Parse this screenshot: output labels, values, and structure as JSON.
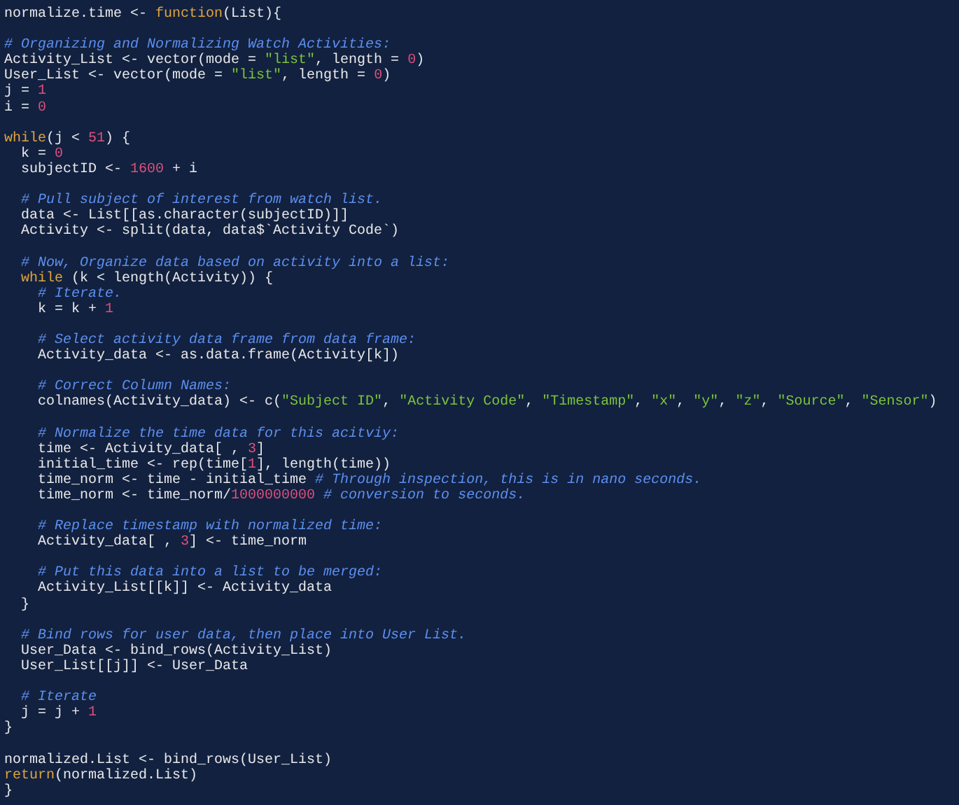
{
  "editor": {
    "lines": [
      {
        "kind": "code",
        "tokens": [
          {
            "kind": "plain",
            "text": "normalize.time <- "
          },
          {
            "kind": "keyword",
            "text": "function"
          },
          {
            "kind": "plain",
            "text": "(List){"
          }
        ]
      },
      {
        "kind": "blank"
      },
      {
        "kind": "code",
        "tokens": [
          {
            "kind": "comment",
            "text": "# Organizing and Normalizing Watch Activities:"
          }
        ]
      },
      {
        "kind": "code",
        "tokens": [
          {
            "kind": "plain",
            "text": "Activity_List <- vector(mode = "
          },
          {
            "kind": "string",
            "text": "\"list\""
          },
          {
            "kind": "plain",
            "text": ", length = "
          },
          {
            "kind": "number",
            "text": "0"
          },
          {
            "kind": "plain",
            "text": ")"
          }
        ]
      },
      {
        "kind": "code",
        "tokens": [
          {
            "kind": "plain",
            "text": "User_List <- vector(mode = "
          },
          {
            "kind": "string",
            "text": "\"list\""
          },
          {
            "kind": "plain",
            "text": ", length = "
          },
          {
            "kind": "number",
            "text": "0"
          },
          {
            "kind": "plain",
            "text": ")"
          }
        ]
      },
      {
        "kind": "code",
        "tokens": [
          {
            "kind": "plain",
            "text": "j = "
          },
          {
            "kind": "number",
            "text": "1"
          }
        ]
      },
      {
        "kind": "code",
        "tokens": [
          {
            "kind": "plain",
            "text": "i = "
          },
          {
            "kind": "number",
            "text": "0"
          }
        ]
      },
      {
        "kind": "blank"
      },
      {
        "kind": "code",
        "tokens": [
          {
            "kind": "keyword",
            "text": "while"
          },
          {
            "kind": "plain",
            "text": "(j < "
          },
          {
            "kind": "number",
            "text": "51"
          },
          {
            "kind": "plain",
            "text": ") {"
          }
        ]
      },
      {
        "kind": "code",
        "tokens": [
          {
            "kind": "plain",
            "text": "  k = "
          },
          {
            "kind": "number",
            "text": "0"
          }
        ]
      },
      {
        "kind": "code",
        "tokens": [
          {
            "kind": "plain",
            "text": "  subjectID <- "
          },
          {
            "kind": "number",
            "text": "1600"
          },
          {
            "kind": "plain",
            "text": " + i"
          }
        ]
      },
      {
        "kind": "blank"
      },
      {
        "kind": "code",
        "tokens": [
          {
            "kind": "comment",
            "text": "  # Pull subject of interest from watch list."
          }
        ]
      },
      {
        "kind": "code",
        "tokens": [
          {
            "kind": "plain",
            "text": "  data <- List[[as.character(subjectID)]]"
          }
        ]
      },
      {
        "kind": "code",
        "tokens": [
          {
            "kind": "plain",
            "text": "  Activity <- split(data, data$`Activity Code`)"
          }
        ]
      },
      {
        "kind": "blank"
      },
      {
        "kind": "code",
        "tokens": [
          {
            "kind": "comment",
            "text": "  # Now, Organize data based on activity into a list:"
          }
        ]
      },
      {
        "kind": "code",
        "tokens": [
          {
            "kind": "keyword",
            "text": "  while"
          },
          {
            "kind": "plain",
            "text": " (k < length(Activity)) {"
          }
        ]
      },
      {
        "kind": "code",
        "tokens": [
          {
            "kind": "comment",
            "text": "    # Iterate."
          }
        ]
      },
      {
        "kind": "code",
        "tokens": [
          {
            "kind": "plain",
            "text": "    k = k + "
          },
          {
            "kind": "number",
            "text": "1"
          }
        ]
      },
      {
        "kind": "blank"
      },
      {
        "kind": "code",
        "tokens": [
          {
            "kind": "comment",
            "text": "    # Select activity data frame from data frame:"
          }
        ]
      },
      {
        "kind": "code",
        "tokens": [
          {
            "kind": "plain",
            "text": "    Activity_data <- as.data.frame(Activity[k])"
          }
        ]
      },
      {
        "kind": "blank"
      },
      {
        "kind": "code",
        "tokens": [
          {
            "kind": "comment",
            "text": "    # Correct Column Names:"
          }
        ]
      },
      {
        "kind": "code",
        "tokens": [
          {
            "kind": "plain",
            "text": "    colnames(Activity_data) <- c("
          },
          {
            "kind": "string",
            "text": "\"Subject ID\""
          },
          {
            "kind": "plain",
            "text": ", "
          },
          {
            "kind": "string",
            "text": "\"Activity Code\""
          },
          {
            "kind": "plain",
            "text": ", "
          },
          {
            "kind": "string",
            "text": "\"Timestamp\""
          },
          {
            "kind": "plain",
            "text": ", "
          },
          {
            "kind": "string",
            "text": "\"x\""
          },
          {
            "kind": "plain",
            "text": ", "
          },
          {
            "kind": "string",
            "text": "\"y\""
          },
          {
            "kind": "plain",
            "text": ", "
          },
          {
            "kind": "string",
            "text": "\"z\""
          },
          {
            "kind": "plain",
            "text": ", "
          },
          {
            "kind": "string",
            "text": "\"Source\""
          },
          {
            "kind": "plain",
            "text": ", "
          },
          {
            "kind": "string",
            "text": "\"Sensor\""
          },
          {
            "kind": "plain",
            "text": ")"
          }
        ]
      },
      {
        "kind": "blank"
      },
      {
        "kind": "code",
        "tokens": [
          {
            "kind": "comment",
            "text": "    # Normalize the time data for this acitviy:"
          }
        ]
      },
      {
        "kind": "code",
        "tokens": [
          {
            "kind": "plain",
            "text": "    time <- Activity_data[ , "
          },
          {
            "kind": "number",
            "text": "3"
          },
          {
            "kind": "plain",
            "text": "]"
          }
        ]
      },
      {
        "kind": "code",
        "tokens": [
          {
            "kind": "plain",
            "text": "    initial_time <- rep(time["
          },
          {
            "kind": "number",
            "text": "1"
          },
          {
            "kind": "plain",
            "text": "], length(time))"
          }
        ]
      },
      {
        "kind": "code",
        "tokens": [
          {
            "kind": "plain",
            "text": "    time_norm <- time - initial_time "
          },
          {
            "kind": "comment",
            "text": "# Through inspection, this is in nano seconds."
          }
        ]
      },
      {
        "kind": "code",
        "tokens": [
          {
            "kind": "plain",
            "text": "    time_norm <- time_norm/"
          },
          {
            "kind": "number",
            "text": "1000000000"
          },
          {
            "kind": "comment",
            "text": " # conversion to seconds."
          }
        ]
      },
      {
        "kind": "blank"
      },
      {
        "kind": "code",
        "tokens": [
          {
            "kind": "comment",
            "text": "    # Replace timestamp with normalized time:"
          }
        ]
      },
      {
        "kind": "code",
        "tokens": [
          {
            "kind": "plain",
            "text": "    Activity_data[ , "
          },
          {
            "kind": "number",
            "text": "3"
          },
          {
            "kind": "plain",
            "text": "] <- time_norm"
          }
        ]
      },
      {
        "kind": "blank"
      },
      {
        "kind": "code",
        "tokens": [
          {
            "kind": "comment",
            "text": "    # Put this data into a list to be merged:"
          }
        ]
      },
      {
        "kind": "code",
        "tokens": [
          {
            "kind": "plain",
            "text": "    Activity_List[[k]] <- Activity_data"
          }
        ]
      },
      {
        "kind": "code",
        "tokens": [
          {
            "kind": "plain",
            "text": "  }"
          }
        ]
      },
      {
        "kind": "blank"
      },
      {
        "kind": "code",
        "tokens": [
          {
            "kind": "comment",
            "text": "  # Bind rows for user data, then place into User List."
          }
        ]
      },
      {
        "kind": "code",
        "tokens": [
          {
            "kind": "plain",
            "text": "  User_Data <- bind_rows(Activity_List)"
          }
        ]
      },
      {
        "kind": "code",
        "tokens": [
          {
            "kind": "plain",
            "text": "  User_List[[j]] <- User_Data"
          }
        ]
      },
      {
        "kind": "blank"
      },
      {
        "kind": "code",
        "tokens": [
          {
            "kind": "comment",
            "text": "  # Iterate"
          }
        ]
      },
      {
        "kind": "code",
        "tokens": [
          {
            "kind": "plain",
            "text": "  j = j + "
          },
          {
            "kind": "number",
            "text": "1"
          }
        ]
      },
      {
        "kind": "code",
        "tokens": [
          {
            "kind": "plain",
            "text": "}"
          }
        ]
      },
      {
        "kind": "blank"
      },
      {
        "kind": "code",
        "tokens": [
          {
            "kind": "plain",
            "text": "normalized.List <- bind_rows(User_List)"
          }
        ]
      },
      {
        "kind": "code",
        "tokens": [
          {
            "kind": "keyword",
            "text": "return"
          },
          {
            "kind": "plain",
            "text": "(normalized.List)"
          }
        ]
      },
      {
        "kind": "code",
        "tokens": [
          {
            "kind": "plain",
            "text": "}"
          }
        ]
      }
    ]
  }
}
